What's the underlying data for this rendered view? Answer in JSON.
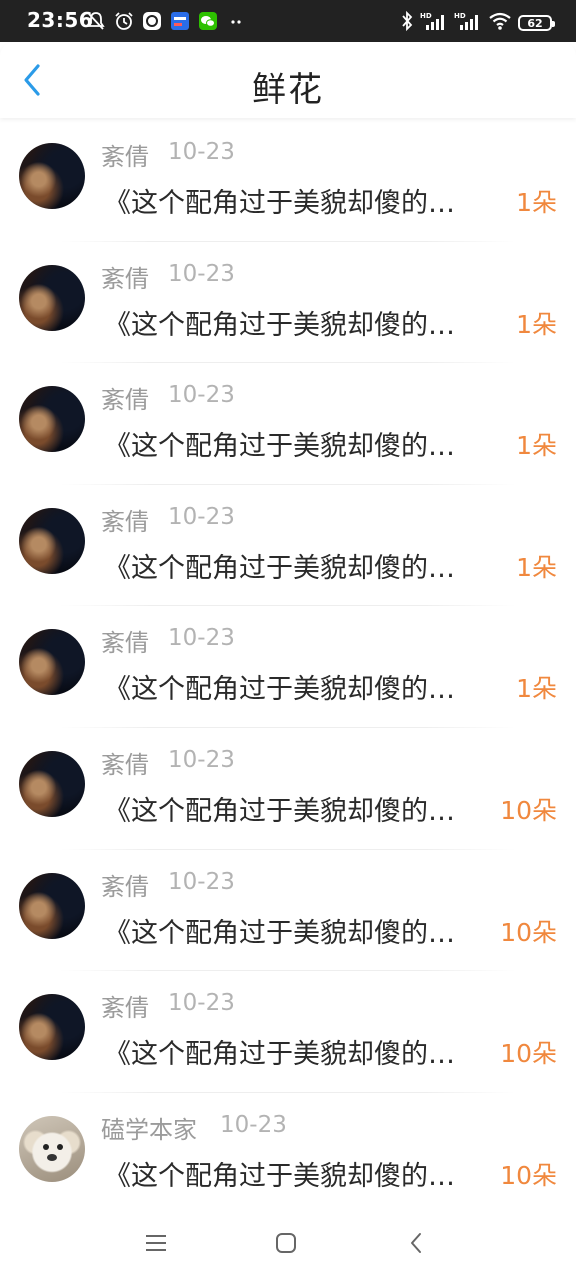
{
  "status_bar": {
    "time": "23:56",
    "battery": "62"
  },
  "header": {
    "title": "鲜花"
  },
  "items": [
    {
      "name": "紊倩",
      "date": "10-23",
      "title": "《这个配角过于美貌却傻的…",
      "count": "1朵",
      "avatar": "dark"
    },
    {
      "name": "紊倩",
      "date": "10-23",
      "title": "《这个配角过于美貌却傻的…",
      "count": "1朵",
      "avatar": "dark"
    },
    {
      "name": "紊倩",
      "date": "10-23",
      "title": "《这个配角过于美貌却傻的…",
      "count": "1朵",
      "avatar": "dark"
    },
    {
      "name": "紊倩",
      "date": "10-23",
      "title": "《这个配角过于美貌却傻的…",
      "count": "1朵",
      "avatar": "dark"
    },
    {
      "name": "紊倩",
      "date": "10-23",
      "title": "《这个配角过于美貌却傻的…",
      "count": "1朵",
      "avatar": "dark"
    },
    {
      "name": "紊倩",
      "date": "10-23",
      "title": "《这个配角过于美貌却傻的…",
      "count": "10朵",
      "avatar": "dark"
    },
    {
      "name": "紊倩",
      "date": "10-23",
      "title": "《这个配角过于美貌却傻的…",
      "count": "10朵",
      "avatar": "dark"
    },
    {
      "name": "紊倩",
      "date": "10-23",
      "title": "《这个配角过于美貌却傻的…",
      "count": "10朵",
      "avatar": "dark"
    },
    {
      "name": "磕学本家",
      "date": "10-23",
      "title": "《这个配角过于美貌却傻的…",
      "count": "10朵",
      "avatar": "dog"
    }
  ],
  "colors": {
    "accent_blue": "#2b9be8",
    "count_orange": "#f0883e",
    "status_bar_bg": "#222222"
  },
  "icons": {
    "back": "chevron-left-icon",
    "nav_menu": "menu-icon",
    "nav_home": "home-square-icon",
    "nav_back": "back-icon"
  }
}
